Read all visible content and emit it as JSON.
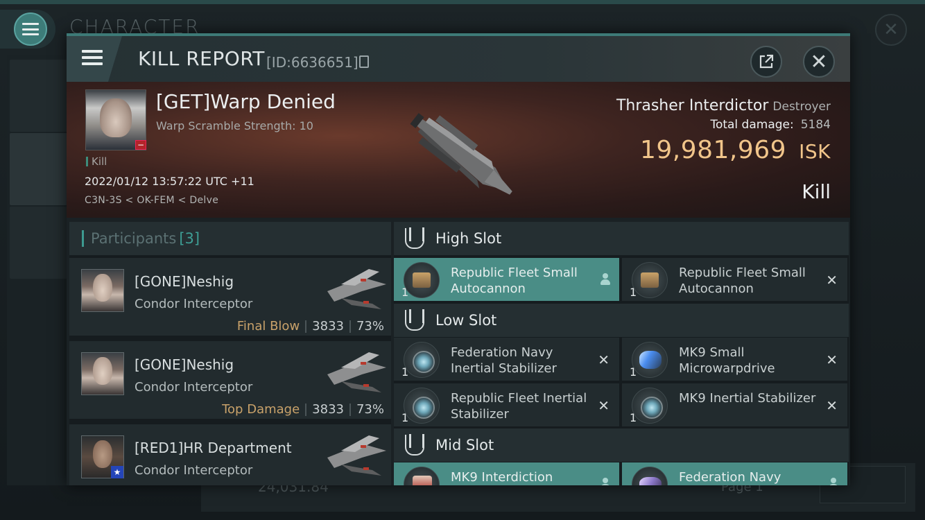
{
  "background": {
    "title": "CHARACTER",
    "isk_value": "24,031.84",
    "page_label": "Page 1"
  },
  "window": {
    "title": "KILL REPORT",
    "id_label": "[ID:6636651]"
  },
  "victim": {
    "name": "[GET]Warp Denied",
    "subtitle": "Warp Scramble Strength: 10",
    "kill_tag": "Kill",
    "datetime": "2022/01/12 13:57:22 UTC +11",
    "location": "C3N-3S < OK-FEM < Delve"
  },
  "ship": {
    "name": "Thrasher Interdictor",
    "class": "Destroyer",
    "total_damage_label": "Total damage:",
    "total_damage": "5184",
    "isk_value": "19,981,969",
    "isk_unit": "ISK",
    "result": "Kill"
  },
  "participants": {
    "label": "Participants",
    "count": "[3]",
    "rows": [
      {
        "name": "[GONE]Neshig",
        "ship": "Condor Interceptor",
        "role": "Final Blow",
        "damage": "3833",
        "percent": "73%"
      },
      {
        "name": "[GONE]Neshig",
        "ship": "Condor Interceptor",
        "role": "Top Damage",
        "damage": "3833",
        "percent": "73%"
      },
      {
        "name": "[RED1]HR Department",
        "ship": "Condor Interceptor"
      }
    ]
  },
  "slots": {
    "high": {
      "label": "High Slot",
      "items": [
        {
          "name": "Republic Fleet Small Autocannon",
          "qty": "1",
          "icon": "autocannon-icon",
          "status": "dropped"
        },
        {
          "name": "Republic Fleet Small Autocannon",
          "qty": "1",
          "icon": "autocannon-icon",
          "status": "destroyed"
        }
      ]
    },
    "low": {
      "label": "Low Slot",
      "items": [
        {
          "name": "Federation Navy Inertial Stabilizer",
          "qty": "1",
          "icon": "inertial-stabilizer-icon",
          "status": "destroyed"
        },
        {
          "name": "MK9 Small Microwarpdrive",
          "qty": "1",
          "icon": "microwarpdrive-icon",
          "status": "destroyed"
        },
        {
          "name": "Republic Fleet Inertial Stabilizer",
          "qty": "1",
          "icon": "inertial-stabilizer-icon",
          "status": "destroyed"
        },
        {
          "name": "MK9 Inertial Stabilizer",
          "qty": "1",
          "icon": "inertial-stabilizer-icon",
          "status": "destroyed"
        }
      ]
    },
    "mid": {
      "label": "Mid Slot",
      "items": [
        {
          "name": "MK9 Interdiction",
          "icon": "interdiction-icon",
          "status": "dropped"
        },
        {
          "name": "Federation Navy",
          "icon": "module-icon",
          "status": "dropped"
        }
      ]
    }
  },
  "colors": {
    "accent": "#3d7a77",
    "isk": "#f1c58a",
    "highlight_row": "#4a8d86",
    "final_blow": "#c9a26a"
  }
}
